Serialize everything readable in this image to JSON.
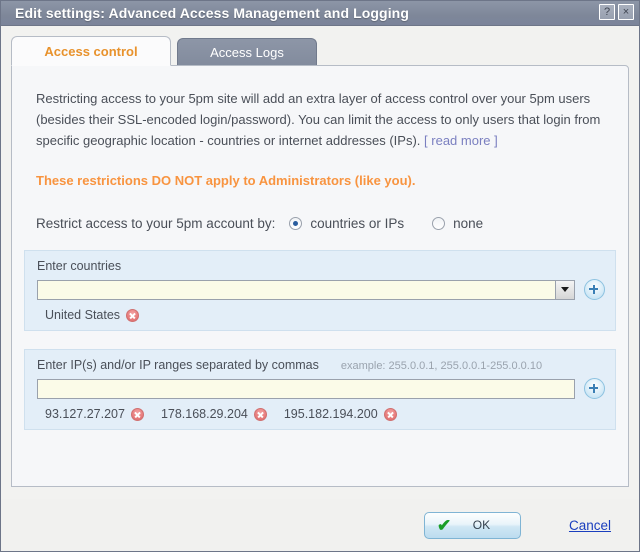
{
  "window": {
    "title": "Edit settings: Advanced Access Management and Logging",
    "help_button": "?",
    "close_button": "×",
    "titlebar_color": "#828b9d"
  },
  "tabs": [
    {
      "label": "Access control",
      "active": true
    },
    {
      "label": "Access Logs",
      "active": false
    }
  ],
  "content": {
    "intro_text": "Restricting access to your 5pm site will add an extra layer of access control over your 5pm users (besides their SSL-encoded login/password). You can limit the access to only users that login from specific geographic location - countries or internet addresses (IPs).",
    "read_more_label": "[ read more ]",
    "warning_text": "These restrictions DO NOT apply to Administrators (like you).",
    "warning_color": "#f89440",
    "restrict_label": "Restrict access to your 5pm account by:",
    "radio_options": [
      {
        "label": "countries or IPs",
        "checked": true
      },
      {
        "label": "none",
        "checked": false
      }
    ]
  },
  "countries_panel": {
    "heading": "Enter countries",
    "input_value": "",
    "input_placeholder": "",
    "dropdown_icon": "chevron-down-icon",
    "add_icon": "plus-circle-icon",
    "chips": [
      {
        "label": "United States",
        "remove_icon": "remove-circle-icon"
      }
    ]
  },
  "ips_panel": {
    "heading": "Enter IP(s) and/or IP ranges separated by commas",
    "example": "example: 255.0.0.1, 255.0.0.1-255.0.0.10",
    "input_value": "",
    "input_placeholder": "",
    "add_icon": "plus-circle-icon",
    "chips": [
      {
        "label": "93.127.27.207",
        "remove_icon": "remove-circle-icon"
      },
      {
        "label": "178.168.29.204",
        "remove_icon": "remove-circle-icon"
      },
      {
        "label": "195.182.194.200",
        "remove_icon": "remove-circle-icon"
      }
    ]
  },
  "footer": {
    "ok_label": "OK",
    "ok_icon": "check-icon",
    "cancel_label": "Cancel"
  }
}
